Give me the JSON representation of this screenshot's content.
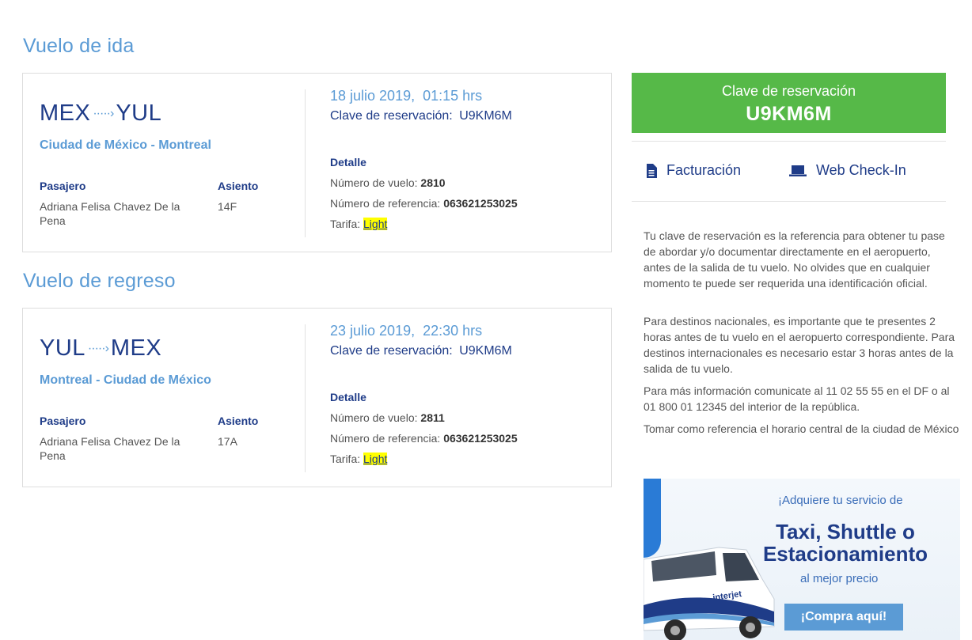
{
  "outbound": {
    "section_title": "Vuelo de ida",
    "origin": "MEX",
    "destination": "YUL",
    "cities": "Ciudad de México - Montreal",
    "passenger_label": "Pasajero",
    "passenger_name": "Adriana Felisa Chavez De la Pena",
    "seat_label": "Asiento",
    "seat": "14F",
    "datetime": "18 julio 2019,  01:15 hrs",
    "clave_label": "Clave de reservación:",
    "clave": "U9KM6M",
    "detail_title": "Detalle",
    "flight_label": "Número de vuelo:",
    "flight": "2810",
    "ref_label": "Número de referencia:",
    "ref": "063621253025",
    "fare_label": "Tarifa:",
    "fare": "Light"
  },
  "return": {
    "section_title": "Vuelo de regreso",
    "origin": "YUL",
    "destination": "MEX",
    "cities": "Montreal - Ciudad de México",
    "passenger_label": "Pasajero",
    "passenger_name": "Adriana Felisa Chavez De la Pena",
    "seat_label": "Asiento",
    "seat": "17A",
    "datetime": "23 julio 2019,  22:30 hrs",
    "clave_label": "Clave de reservación:",
    "clave": "U9KM6M",
    "detail_title": "Detalle",
    "flight_label": "Número de vuelo:",
    "flight": "2811",
    "ref_label": "Número de referencia:",
    "ref": "063621253025",
    "fare_label": "Tarifa:",
    "fare": "Light"
  },
  "sidebar": {
    "reservation_title": "Clave de reservación",
    "reservation_code": "U9KM6M",
    "billing_label": "Facturación",
    "checkin_label": "Web Check-In",
    "info": [
      "Tu clave de reservación es la referencia para obtener tu pase de abordar y/o documentar directamente en el aeropuerto, antes de la salida de tu vuelo. No olvides que en cualquier momento te puede ser requerida una identificación oficial.",
      "Para destinos nacionales, es importante que te presentes 2 horas antes de tu vuelo en el aeropuerto correspondiente. Para destinos internacionales es necesario estar 3 horas antes de la salida de tu vuelo.",
      "Para más información comunicate al 11 02 55 55 en el DF o al 01 800 01 12345 del interior de la república.",
      "Tomar como referencia el horario central de la ciudad de México"
    ],
    "colors": {
      "reservation_bg": "#56b948",
      "accent": "#5b9bd5",
      "navy": "#1f3c88"
    }
  },
  "promo": {
    "line1": "¡Adquiere tu servicio de",
    "headline": "Taxi, Shuttle o Estacionamiento",
    "line3": "al mejor precio",
    "button": "¡Compra aquí!",
    "van_brand": "interjet"
  }
}
